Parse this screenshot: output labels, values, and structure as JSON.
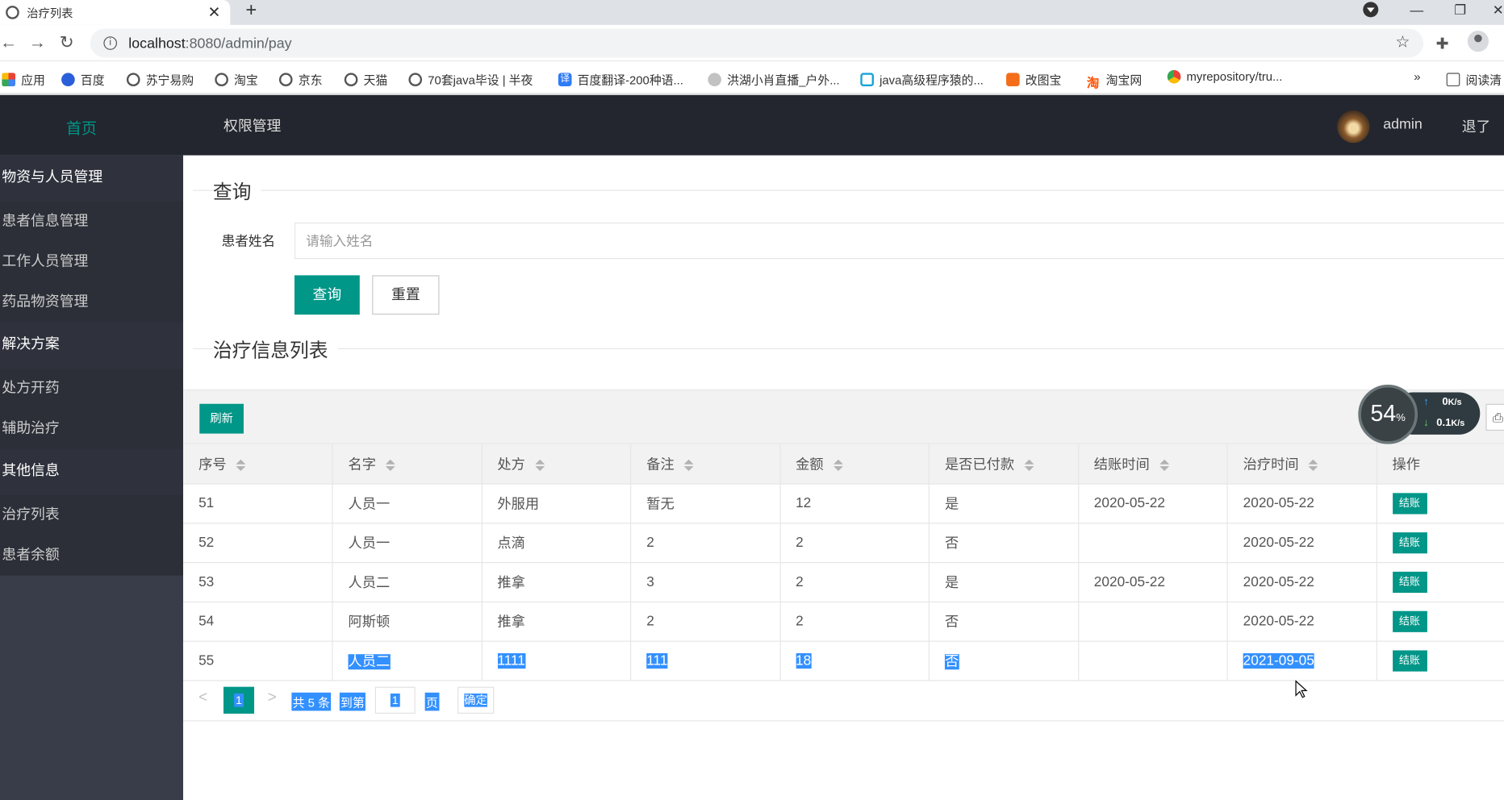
{
  "browser": {
    "tab_title": "治疗列表",
    "url_host": "localhost",
    "url_rest": ":8080/admin/pay",
    "bookmarks": [
      {
        "label": "应用",
        "icon": "grid"
      },
      {
        "label": "百度",
        "icon": "paw"
      },
      {
        "label": "苏宁易购",
        "icon": "globe"
      },
      {
        "label": "淘宝",
        "icon": "globe"
      },
      {
        "label": "京东",
        "icon": "globe"
      },
      {
        "label": "天猫",
        "icon": "globe"
      },
      {
        "label": "70套java毕设 | 半夜",
        "icon": "globe"
      },
      {
        "label": "百度翻译-200种语...",
        "icon": "tr"
      },
      {
        "label": "洪湖小肖直播_户外...",
        "icon": "bird"
      },
      {
        "label": "java高级程序猿的...",
        "icon": "tv"
      },
      {
        "label": "改图宝",
        "icon": "orng"
      },
      {
        "label": "淘宝网",
        "icon": "taob"
      },
      {
        "label": "myrepository/tru...",
        "icon": "chrome"
      }
    ],
    "more": "»",
    "reading_list": "阅读清"
  },
  "header": {
    "home": "首页",
    "permissions": "权限管理",
    "username": "admin",
    "logout": "退了"
  },
  "sidebar": {
    "groups": [
      {
        "title": "物资与人员管理",
        "items": [
          "患者信息管理",
          "工作人员管理",
          "药品物资管理"
        ]
      },
      {
        "title": "解决方案",
        "items": [
          "处方开药",
          "辅助治疗"
        ]
      },
      {
        "title": "其他信息",
        "items": [
          "治疗列表",
          "患者余额"
        ]
      }
    ]
  },
  "search": {
    "legend": "查询",
    "label": "患者姓名",
    "placeholder": "请输入姓名",
    "query_btn": "查询",
    "reset_btn": "重置"
  },
  "list": {
    "legend": "治疗信息列表",
    "refresh_btn": "刷新",
    "speed": {
      "percent": "54",
      "unit": "%",
      "up": "0",
      "up_unit": "K/s",
      "down": "0.1",
      "down_unit": "K/s"
    },
    "columns": [
      "序号",
      "名字",
      "处方",
      "备注",
      "金额",
      "是否已付款",
      "结账时间",
      "治疗时间",
      "操作"
    ],
    "rows": [
      {
        "id": "51",
        "name": "人员一",
        "prescription": "外服用",
        "note": "暂无",
        "amount": "12",
        "paid": "是",
        "settle_time": "2020-05-22",
        "treat_time": "2020-05-22",
        "action": "结账"
      },
      {
        "id": "52",
        "name": "人员一",
        "prescription": "点滴",
        "note": "2",
        "amount": "2",
        "paid": "否",
        "settle_time": "",
        "treat_time": "2020-05-22",
        "action": "结账"
      },
      {
        "id": "53",
        "name": "人员二",
        "prescription": "推拿",
        "note": "3",
        "amount": "2",
        "paid": "是",
        "settle_time": "2020-05-22",
        "treat_time": "2020-05-22",
        "action": "结账"
      },
      {
        "id": "54",
        "name": "阿斯顿",
        "prescription": "推拿",
        "note": "2",
        "amount": "2",
        "paid": "否",
        "settle_time": "",
        "treat_time": "2020-05-22",
        "action": "结账"
      },
      {
        "id": "55",
        "name": "人员二",
        "prescription": "1111",
        "note": "111",
        "amount": "18",
        "paid": "否",
        "settle_time": "",
        "treat_time": "2021-09-05",
        "action": "结账"
      }
    ],
    "pager": {
      "prev": "<",
      "current": "1",
      "next": ">",
      "total": "共 5 条",
      "goto": "到第",
      "page_input": "1",
      "page_unit": "页",
      "confirm": "确定"
    }
  },
  "colors": {
    "accent": "#009688",
    "header_bg": "#23262e",
    "sidebar_bg": "#393d49",
    "selection": "#3390ff"
  }
}
